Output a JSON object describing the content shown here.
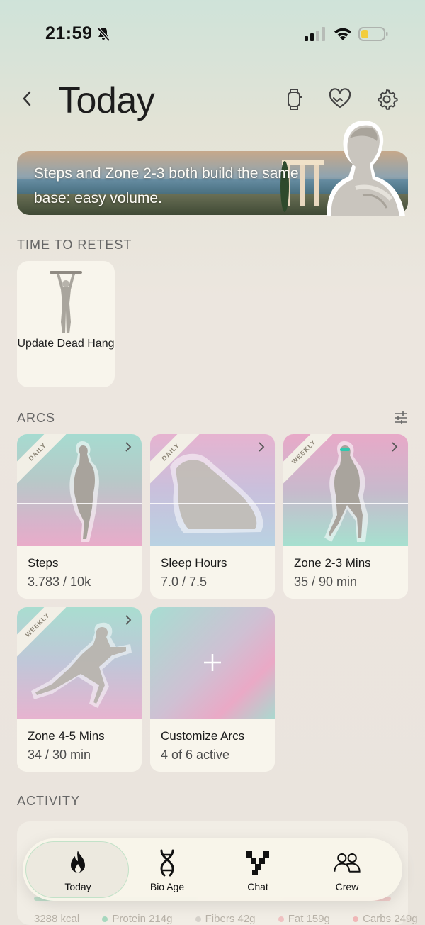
{
  "status_bar": {
    "time": "21:59"
  },
  "header": {
    "title": "Today"
  },
  "banner": {
    "text": "Steps and Zone 2-3 both build the same base: easy volume."
  },
  "sections": {
    "retest": "TIME TO RETEST",
    "arcs": "ARCS",
    "activity": "ACTIVITY"
  },
  "retest_cards": [
    {
      "label": "Update Dead Hang"
    }
  ],
  "arcs": [
    {
      "ribbon": "DAILY",
      "name": "Steps",
      "value": "3.783 / 10k"
    },
    {
      "ribbon": "DAILY",
      "name": "Sleep Hours",
      "value": "7.0 / 7.5"
    },
    {
      "ribbon": "WEEKLY",
      "name": "Zone 2-3 Mins",
      "value": "35 / 90 min"
    },
    {
      "ribbon": "WEEKLY",
      "name": "Zone 4-5 Mins",
      "value": "34 / 30 min"
    },
    {
      "name": "Customize Arcs",
      "value": "4 of 6 active"
    }
  ],
  "activity": {
    "macros": [
      {
        "label": "3288 kcal",
        "color": ""
      },
      {
        "label": "Protein 214g",
        "color": "#a8d8bf"
      },
      {
        "label": "Fibers 42g",
        "color": "#d6d2cb"
      },
      {
        "label": "Fat 159g",
        "color": "#f0c2c2"
      },
      {
        "label": "Carbs 249g",
        "color": "#f0b8b8"
      }
    ]
  },
  "tabs": [
    {
      "label": "Today",
      "icon": "flame-icon",
      "active": true
    },
    {
      "label": "Bio Age",
      "icon": "dna-icon"
    },
    {
      "label": "Chat",
      "icon": "chat-logo-icon"
    },
    {
      "label": "Crew",
      "icon": "people-icon"
    }
  ]
}
